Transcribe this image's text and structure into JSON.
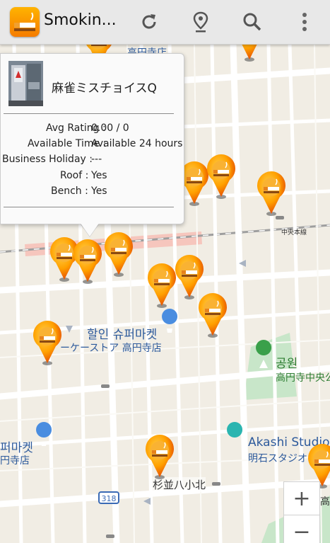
{
  "appbar": {
    "title": "Smokin...",
    "icons": [
      "cigarette-app-icon",
      "refresh-icon",
      "location-pin-icon",
      "search-icon",
      "overflow-menu-icon"
    ]
  },
  "popup": {
    "name": "麻雀ミスチョイスQ",
    "fields": [
      {
        "label": "Avg Rating :",
        "value": "0.00   / 0"
      },
      {
        "label": "Available Time :",
        "value": "Available 24 hours"
      },
      {
        "label": "Business Holiday :",
        "value": "---"
      },
      {
        "label": "Roof :",
        "value": "Yes"
      },
      {
        "label": "Bench :",
        "value": "Yes"
      }
    ]
  },
  "map": {
    "labels": {
      "store_ko": "할인 슈퍼마켓",
      "store_ja": "ーケーストア 高円寺店",
      "park_ko": "공원",
      "park_ja": "高円寺中央公",
      "mart_ko": "퍼마켓",
      "mart_ja": "円寺店",
      "studio_en": "Akashi Studio",
      "studio_ja": "明石スタジオ",
      "school": "杉並八小北",
      "rail": "中央本線",
      "route": "318",
      "top_partial": "高円寺店",
      "right_partial": "高"
    }
  },
  "zoom": {
    "in": "+",
    "out": "−"
  }
}
